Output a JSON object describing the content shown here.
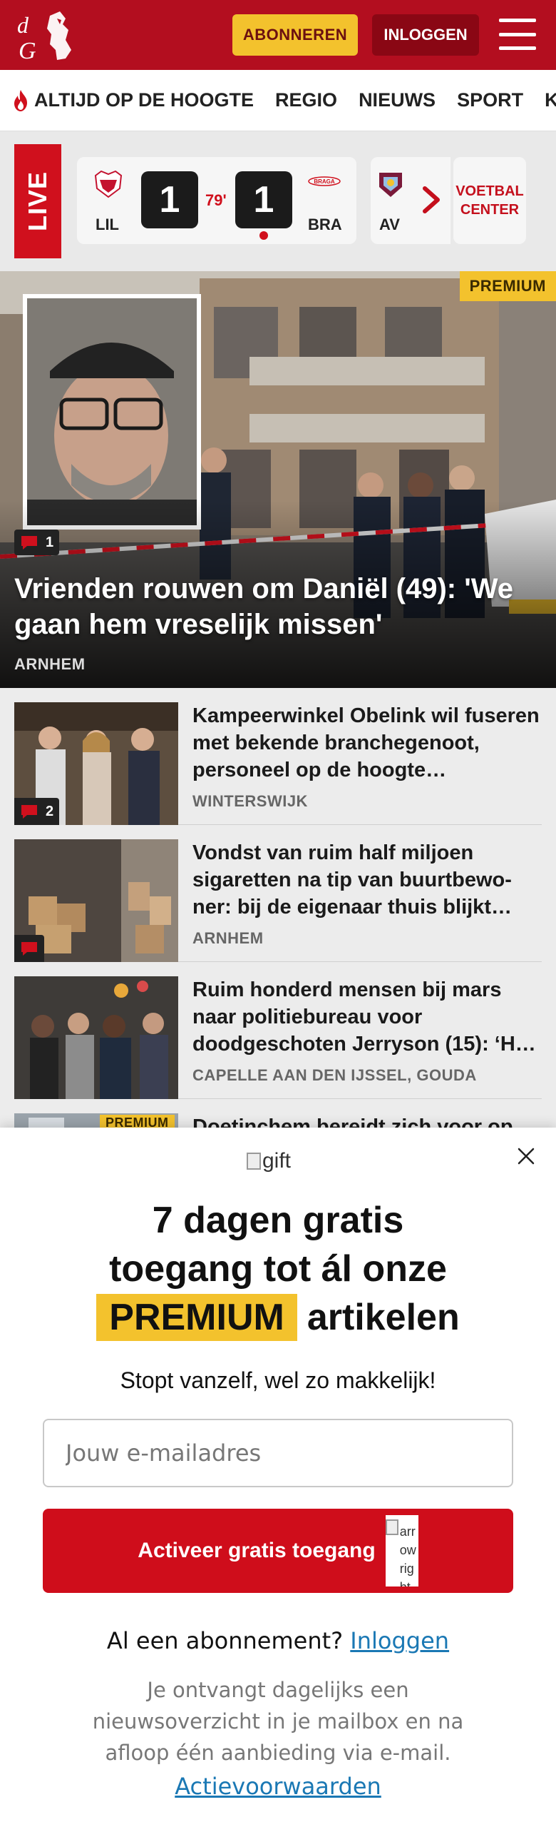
{
  "header": {
    "logo_alt": "dG",
    "subscribe_label": "ABONNEREN",
    "login_label": "INLOGGEN",
    "menu_icon": "hamburger-icon",
    "brand_color": "#b30e1f"
  },
  "nav": {
    "items": [
      "ALTIJD OP DE HOOGTE",
      "REGIO",
      "NIEUWS",
      "SPORT",
      "KIJK"
    ]
  },
  "live": {
    "label": "LIVE",
    "match": {
      "home": "LIL",
      "home_score": "1",
      "minute": "79'",
      "away_score": "1",
      "away": "BRA"
    },
    "next_team": "AV",
    "voetbal_center": "VOETBAL CENTER"
  },
  "hero": {
    "badge": "PREMIUM",
    "comments": "1",
    "title": "Vrienden rouwen om Daniël (49): 'We gaan hem vreselijk missen'",
    "location": "ARNHEM"
  },
  "articles": [
    {
      "title": "Kampeerwinkel Obelink wil fuseren met bekende branche­genoot, personeel op de hoogte…",
      "location": "WINTERSWIJK",
      "comments": "2"
    },
    {
      "title": "Vondst van ruim half miljoen sigaretten na tip van buurtbewo­ner: bij de eigenaar thuis blijkt…",
      "location": "ARNHEM",
      "comments": ""
    },
    {
      "title": "Ruim honderd mensen bij mars naar politiebureau voor doodgeschoten Jerryson (15): ‘H…",
      "location": "CAPELLE AAN DEN IJSSEL, GOUDA",
      "comments": null
    },
    {
      "title": "Doetinchem bereidt zich voor op",
      "badge": "PREMIUM"
    }
  ],
  "overlay": {
    "gift_alt": "gift",
    "heading_line1": "7 dagen gratis",
    "heading_line2": "toegang tot ál onze",
    "heading_premium": "PREMIUM",
    "heading_line3": "artikelen",
    "subheading": "Stopt vanzelf, wel zo makkelijk!",
    "email_placeholder": "Jouw e-mailadres",
    "activate_label": "Activeer gratis toegang",
    "arrow_alt": "arrow right",
    "already_text": "Al een abonnement?",
    "already_link": "Inloggen",
    "info": "Je ontvangt dagelijks een nieuwsoverzicht in je mailbox en na afloop één aanbieding via e-mail.",
    "terms": "Actievoorwaarden"
  }
}
